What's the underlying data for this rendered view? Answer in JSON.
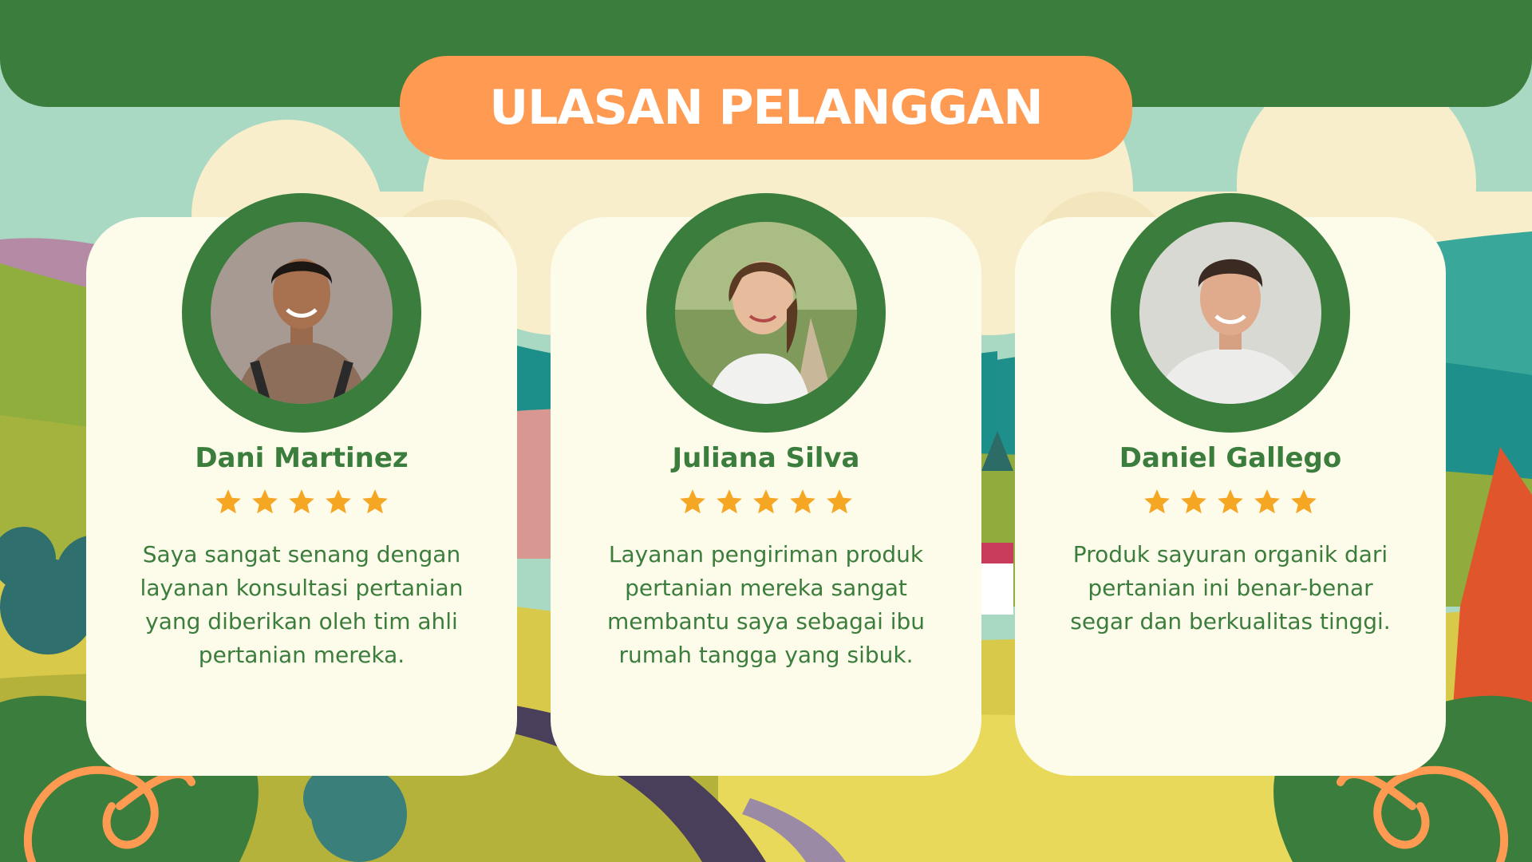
{
  "slide": {
    "title": "ULASAN PELANGGAN"
  },
  "reviews": [
    {
      "name": "Dani Martinez",
      "rating": 5,
      "text": "Saya sangat senang dengan layanan konsultasi pertanian yang diberikan oleh tim ahli pertanian mereka."
    },
    {
      "name": "Juliana Silva",
      "rating": 5,
      "text": "Layanan pengiriman produk pertanian mereka sangat membantu saya sebagai ibu rumah tangga yang sibuk."
    },
    {
      "name": "Daniel Gallego",
      "rating": 5,
      "text": "Produk sayuran organik dari pertanian ini benar-benar segar dan berkualitas tinggi."
    }
  ],
  "colors": {
    "green": "#3b7d3c",
    "orange": "#ff9a52",
    "card": "#fdfbea",
    "star": "#f5a623"
  }
}
